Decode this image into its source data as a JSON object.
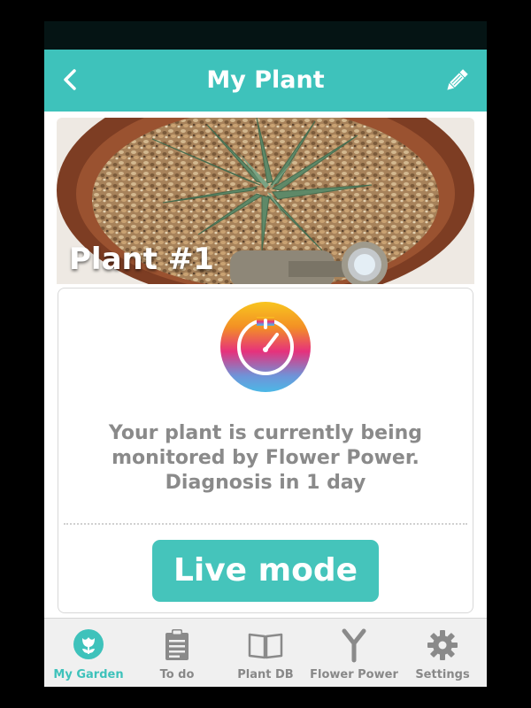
{
  "header": {
    "title": "My Plant",
    "back_icon": "chevron-left-icon",
    "edit_icon": "pencil-icon"
  },
  "plant": {
    "name": "Plant #1"
  },
  "monitor_card": {
    "icon": "gauge-icon",
    "status_line1": "Your plant is currently being",
    "status_line2": "monitored by  Flower Power.",
    "status_line3": "Diagnosis in  1 day",
    "live_button_label": "Live mode"
  },
  "tab_bar": {
    "tabs": [
      {
        "label": "My Garden",
        "icon": "flower-icon",
        "active": true
      },
      {
        "label": "To do",
        "icon": "clipboard-icon",
        "active": false
      },
      {
        "label": "Plant DB",
        "icon": "book-icon",
        "active": false
      },
      {
        "label": "Flower Power",
        "icon": "sensor-y-icon",
        "active": false
      },
      {
        "label": "Settings",
        "icon": "gear-icon",
        "active": false
      }
    ]
  },
  "colors": {
    "accent": "#3ec2bb",
    "text_muted": "#8a8a8a",
    "status_bar": "#051414"
  }
}
